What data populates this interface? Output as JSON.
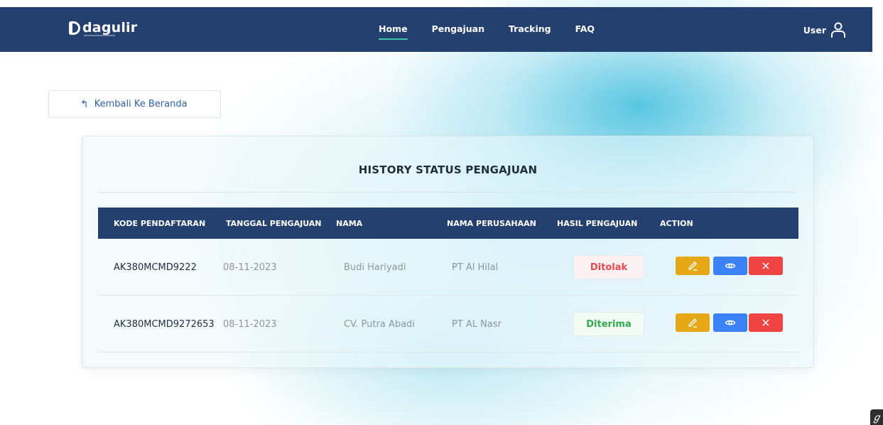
{
  "brand": {
    "name": "dagulir"
  },
  "nav": {
    "items": [
      {
        "label": "Home",
        "active": true
      },
      {
        "label": "Pengajuan",
        "active": false
      },
      {
        "label": "Tracking",
        "active": false
      },
      {
        "label": "FAQ",
        "active": false
      }
    ],
    "user_label": "User",
    "user_icon": "user-icon"
  },
  "back_button": {
    "label": "Kembali Ke Beranda",
    "icon": "arrow-return-left-icon"
  },
  "history": {
    "title": "HISTORY STATUS PENGAJUAN",
    "columns": [
      "KODE PENDAFTARAN",
      "TANGGAL PENGAJUAN",
      "NAMA",
      "NAMA PERUSAHAAN",
      "HASIL PENGAJUAN",
      "ACTION"
    ],
    "rows": [
      {
        "code": "AK380MCMD9222",
        "date": "08-11-2023",
        "name": "Budi Hariyadi",
        "company": "PT Al Hilal",
        "status": "Ditolak",
        "status_type": "rejected"
      },
      {
        "code": "AK380MCMD9272653",
        "date": "08-11-2023",
        "name": "CV. Putra Abadi",
        "company": "PT AL Nasr",
        "status": "Diterima",
        "status_type": "accepted"
      }
    ]
  },
  "colors": {
    "navbar": "#23406e",
    "accent_underline": "#3fbfae",
    "rejected": "#e5484d",
    "accepted": "#2faa4f",
    "edit_button": "#e6a815",
    "view_button": "#3b82f6",
    "delete_button": "#ef4444"
  }
}
